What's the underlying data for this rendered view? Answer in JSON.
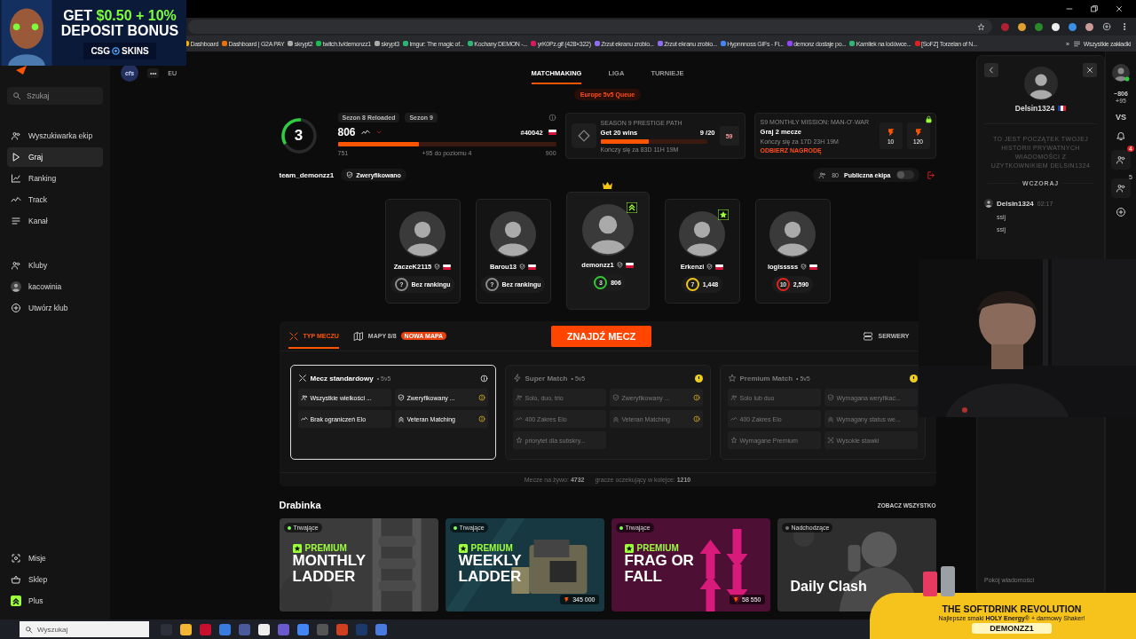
{
  "ad_top": {
    "headline": "GET",
    "amount": "$0.50 + 10%",
    "headline2": "DEPOSIT BONUS",
    "brand_left": "CSG",
    "brand_right": "SKINS"
  },
  "browser": {
    "bookmarks": [
      "Dashboard",
      "Dashboard | G2A PAY",
      "skrypt2",
      "twitch.tv/demonzz1",
      "skrypt3",
      "Imgur: The magic of...",
      "Kochany DEMON -...",
      "yrK0Pz.gif (428×322)",
      "Zrzut ekranu zrobio...",
      "Zrzut ekranu zrobio...",
      "Hypnnnoss GIFs - Fi...",
      "demonz dostaje po...",
      "Kamilek na lodówce...",
      "[SoFZ] Torzelan of N..."
    ],
    "more": "»",
    "all_bookmarks": "Wszystkie zakładki"
  },
  "sidebar": {
    "search_placeholder": "Szukaj",
    "nav": [
      {
        "label": "Wyszukiwarka ekip",
        "selected": false
      },
      {
        "label": "Graj",
        "selected": true
      },
      {
        "label": "Ranking",
        "selected": false
      },
      {
        "label": "Track",
        "selected": false
      },
      {
        "label": "Kanał",
        "selected": false
      }
    ],
    "clubs": [
      "Kluby",
      "kacowinia",
      "Utwórz klub"
    ],
    "bottom": [
      "Misje",
      "Sklep",
      "Plus"
    ]
  },
  "header": {
    "org": "cfs",
    "more": "•••",
    "region": "EU",
    "tabs": [
      {
        "label": "MATCHMAKING",
        "selected": true
      },
      {
        "label": "LIGA",
        "selected": false
      },
      {
        "label": "TURNIEJE",
        "selected": false
      }
    ],
    "queue": "Europe 5v5 Queue"
  },
  "stats": {
    "skill": {
      "number": "3",
      "level": 0.35
    },
    "seasons": [
      "Sezon 8 Reloaded",
      "Sezon 9"
    ],
    "elo": "806",
    "rank": "#40042",
    "progress": {
      "level": 0.37,
      "min": "751",
      "hint": "+95 do poziomu 4",
      "max": "900"
    },
    "prestige": {
      "title": "SEASON 9 PRESTIGE PATH",
      "goal": "Get 20 wins",
      "count": "9 /20",
      "level": 0.45,
      "ends": "Kończy się za 83D 11H 19M",
      "badge": "59"
    },
    "mission": {
      "title": "S9 MONTHLY MISSION: MAN-O'-WAR",
      "goal": "Graj 2 mecze",
      "ends": "Kończy się za 17D 23H 19M",
      "claim": "ODBIERZ NAGRODĘ",
      "rewards": [
        "10",
        "120"
      ]
    }
  },
  "team": {
    "name": "team_demonzz1",
    "verified": "Zweryfikowano",
    "members": "80",
    "public_label": "Publiczna ekipa",
    "public_on": false
  },
  "players": [
    {
      "name": "ZaczeK2115",
      "skill": "?",
      "rating": "Bez rankingu",
      "color": "#8c8c8c",
      "leader": false,
      "kind": "plain"
    },
    {
      "name": "Barou13",
      "skill": "?",
      "rating": "Bez rankingu",
      "color": "#8c8c8c",
      "leader": false,
      "kind": "plain"
    },
    {
      "name": "demonzz1",
      "skill": "3",
      "rating": "806",
      "color": "#32c832",
      "leader": true,
      "kind": "boost"
    },
    {
      "name": "Erkenzi",
      "skill": "7",
      "rating": "1,448",
      "color": "#f0c419",
      "leader": false,
      "kind": "star"
    },
    {
      "name": "logisssss",
      "skill": "10",
      "rating": "2,590",
      "color": "#e3231b",
      "leader": false,
      "kind": "plain"
    }
  ],
  "match": {
    "tabs": [
      {
        "label": "TYP MECZU",
        "selected": true
      },
      {
        "label": "MAPY 8/8",
        "selected": false,
        "tag": "NOWA MAPA"
      }
    ],
    "find": "ZNAJDŹ MECZ",
    "servers": "SERWERY",
    "types": [
      {
        "title": "Mecz standardowy",
        "mode": "• 5v5",
        "selected": true,
        "alert": false,
        "features": [
          {
            "label": "Wszystkie wielkości ...",
            "warning": false
          },
          {
            "label": "Zweryfikowany ...",
            "warning": true
          },
          {
            "label": "Brak ograniczeń Elo",
            "warning": false
          },
          {
            "label": "Veteran Matching",
            "warning": true
          }
        ]
      },
      {
        "title": "Super Match",
        "mode": "• 5v5",
        "selected": false,
        "alert": true,
        "features": [
          {
            "label": "Solo, duo, trio",
            "warning": false
          },
          {
            "label": "Zweryfikowany ...",
            "warning": true
          },
          {
            "label": "400 Zakres Elo",
            "warning": false
          },
          {
            "label": "Veteran Matching",
            "warning": true
          },
          {
            "label": "priorytet dla subskry...",
            "warning": false
          }
        ]
      },
      {
        "title": "Premium Match",
        "mode": "• 5v5",
        "selected": false,
        "alert": true,
        "features": [
          {
            "label": "Solo lub duo",
            "warning": false
          },
          {
            "label": "Wymagana weryfikac...",
            "warning": false
          },
          {
            "label": "400 Zakres Elo",
            "warning": false
          },
          {
            "label": "Wymagany status we...",
            "warning": false
          },
          {
            "label": "Wymagane Premium",
            "warning": false
          },
          {
            "label": "Wysokie stawki",
            "warning": false
          }
        ]
      }
    ],
    "live_label": "Mecze na żywo:",
    "live": "4732",
    "waiting_label": "gracze oczekujący w kolejce:",
    "waiting": "1210"
  },
  "ladders": {
    "title": "Drabinka",
    "see_all": "ZOBACZ WSZYSTKO",
    "cards": [
      {
        "status": "Trwające",
        "live": true,
        "kind": "premium",
        "tier": "PREMIUM",
        "title": "MONTHLY LADDER",
        "color": "#3b3b3b"
      },
      {
        "status": "Trwające",
        "live": true,
        "kind": "premium",
        "tier": "PREMIUM",
        "title": "WEEKLY LADDER",
        "prize": "345 000",
        "color": "#173840"
      },
      {
        "status": "Trwające",
        "live": true,
        "kind": "premium",
        "tier": "PREMIUM",
        "title": "FRAG OR FALL",
        "prize": "58 550",
        "color": "#4d0f33"
      },
      {
        "status": "Nadchodzące",
        "live": false,
        "kind": "plain",
        "title": "Daily Clash",
        "color": "#2e2e2e"
      }
    ]
  },
  "chat": {
    "user": "Delsin1324",
    "intro": "TO JEST POCZĄTEK TWOJEJ HISTORII PRYWATNYCH WIADOMOŚCI Z UŻYTKOWNIKIEM DELSIN1324",
    "day": "WCZORAJ",
    "author": "Delsin1324",
    "time": "02:17",
    "lines": [
      "ssij",
      "ssij"
    ],
    "placeholder": "Pokój wiadomości"
  },
  "rail": {
    "elo": "~806",
    "delta": "+95",
    "vs": "VS",
    "friends_count": "4",
    "party_count": "5"
  },
  "ad_bottom": {
    "headline": "THE SOFTDRINK REVOLUTION",
    "sub": "Najlepsze smaki **HOLY Energy**® + darmowy Shaker!",
    "code": "DEMONZZ1"
  },
  "taskbar": {
    "search_placeholder": "Wyszukaj"
  }
}
